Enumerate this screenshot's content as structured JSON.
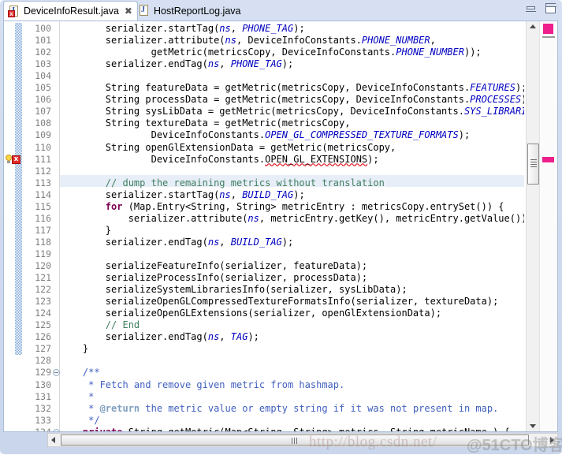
{
  "window": {
    "minimize_label": "Minimize",
    "maximize_label": "Maximize"
  },
  "tabs": [
    {
      "label": "DeviceInfoResult.java",
      "icon": "java-file-error-icon",
      "active": true,
      "close_glyph": "✖"
    },
    {
      "label": "HostReportLog.java",
      "icon": "java-file-icon",
      "active": false,
      "close_glyph": ""
    }
  ],
  "editor": {
    "first_line": 100,
    "last_line": 134,
    "highlighted_line": 111,
    "error_line": 111,
    "fold_lines": [
      129,
      134
    ],
    "colors": {
      "keyword": "#7f0055",
      "string": "#2a00ff",
      "comment": "#3f7f5f",
      "javadoc": "#3f5fbf",
      "static_field": "#0000c0",
      "error_underline": "#e01b24",
      "line_highlight": "#e8eef8",
      "marker": "#ee1e8c"
    },
    "lines": [
      {
        "n": 100,
        "text": "        serializer.startTag(ns, PHONE_TAG);"
      },
      {
        "n": 101,
        "text": "        serializer.attribute(ns, DeviceInfoConstants.PHONE_NUMBER,"
      },
      {
        "n": 102,
        "text": "                getMetric(metricsCopy, DeviceInfoConstants.PHONE_NUMBER));"
      },
      {
        "n": 103,
        "text": "        serializer.endTag(ns, PHONE_TAG);"
      },
      {
        "n": 104,
        "text": ""
      },
      {
        "n": 105,
        "text": "        String featureData = getMetric(metricsCopy, DeviceInfoConstants.FEATURES);"
      },
      {
        "n": 106,
        "text": "        String processData = getMetric(metricsCopy, DeviceInfoConstants.PROCESSES);"
      },
      {
        "n": 107,
        "text": "        String sysLibData = getMetric(metricsCopy, DeviceInfoConstants.SYS_LIBRARIES);"
      },
      {
        "n": 108,
        "text": "        String textureData = getMetric(metricsCopy,"
      },
      {
        "n": 109,
        "text": "                DeviceInfoConstants.OPEN_GL_COMPRESSED_TEXTURE_FORMATS);"
      },
      {
        "n": 110,
        "text": "        String openGlExtensionData = getMetric(metricsCopy,"
      },
      {
        "n": 111,
        "text": "                DeviceInfoConstants.OPEN_GL_EXTENSIONS);"
      },
      {
        "n": 112,
        "text": ""
      },
      {
        "n": 113,
        "text": "        // dump the remaining metrics without translation"
      },
      {
        "n": 114,
        "text": "        serializer.startTag(ns, BUILD_TAG);"
      },
      {
        "n": 115,
        "text": "        for (Map.Entry<String, String> metricEntry : metricsCopy.entrySet()) {"
      },
      {
        "n": 116,
        "text": "            serializer.attribute(ns, metricEntry.getKey(), metricEntry.getValue());"
      },
      {
        "n": 117,
        "text": "        }"
      },
      {
        "n": 118,
        "text": "        serializer.endTag(ns, BUILD_TAG);"
      },
      {
        "n": 119,
        "text": ""
      },
      {
        "n": 120,
        "text": "        serializeFeatureInfo(serializer, featureData);"
      },
      {
        "n": 121,
        "text": "        serializeProcessInfo(serializer, processData);"
      },
      {
        "n": 122,
        "text": "        serializeSystemLibrariesInfo(serializer, sysLibData);"
      },
      {
        "n": 123,
        "text": "        serializeOpenGLCompressedTextureFormatsInfo(serializer, textureData);"
      },
      {
        "n": 124,
        "text": "        serializeOpenGLExtensions(serializer, openGlExtensionData);"
      },
      {
        "n": 125,
        "text": "        // End"
      },
      {
        "n": 126,
        "text": "        serializer.endTag(ns, TAG);"
      },
      {
        "n": 127,
        "text": "    }"
      },
      {
        "n": 128,
        "text": ""
      },
      {
        "n": 129,
        "text": "    /**"
      },
      {
        "n": 130,
        "text": "     * Fetch and remove given metric from hashmap."
      },
      {
        "n": 131,
        "text": "     *"
      },
      {
        "n": 132,
        "text": "     * @return the metric value or empty string if it was not present in map."
      },
      {
        "n": 133,
        "text": "     */"
      },
      {
        "n": 134,
        "text": "    private String getMetric(Map<String, String> metrics, String metricName ) {"
      }
    ]
  },
  "scrollbars": {
    "vertical": {
      "up_glyph": "▲",
      "down_glyph": "▼"
    },
    "horizontal": {
      "left_glyph": "◀",
      "right_glyph": "▶"
    }
  },
  "watermark": {
    "url": "http://blog.csdn.net/",
    "brand": "@51CTO博客"
  }
}
